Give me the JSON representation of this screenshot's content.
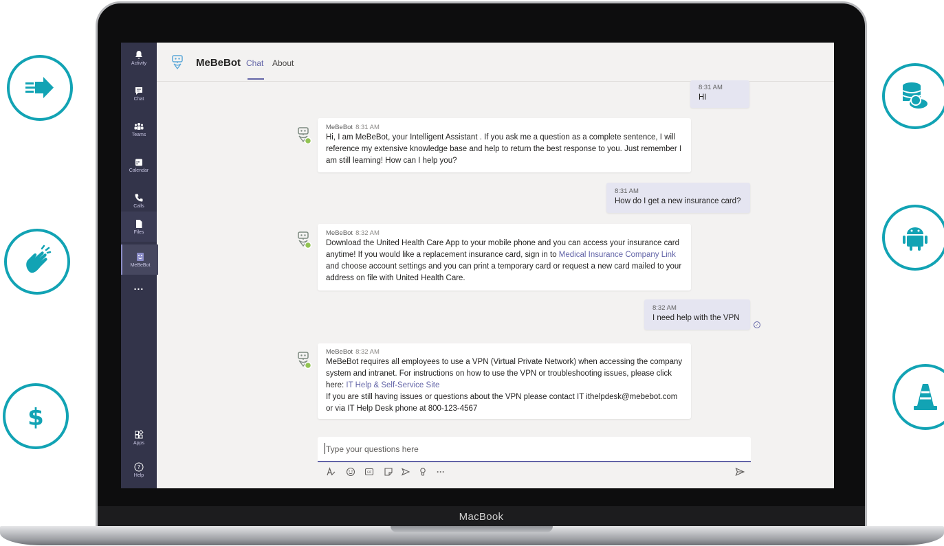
{
  "device": {
    "brand_label": "MacBook"
  },
  "side_icons": {
    "left": [
      "arrow-right-icon",
      "hand-wave-icon",
      "dollar-icon"
    ],
    "right": [
      "database-cloud-icon",
      "android-icon",
      "traffic-cone-icon"
    ],
    "accent_color": "#12a3b4"
  },
  "rail": {
    "items": [
      {
        "label": "Activity",
        "icon": "bell-icon"
      },
      {
        "label": "Chat",
        "icon": "chat-icon"
      },
      {
        "label": "Teams",
        "icon": "teams-icon"
      },
      {
        "label": "Calendar",
        "icon": "calendar-icon"
      },
      {
        "label": "Calls",
        "icon": "phone-icon"
      },
      {
        "label": "Files",
        "icon": "file-icon"
      },
      {
        "label": "MeBeBot",
        "icon": "bot-icon"
      }
    ],
    "more": "...",
    "bottom": [
      {
        "label": "Apps",
        "icon": "apps-icon"
      },
      {
        "label": "Help",
        "icon": "help-icon"
      }
    ],
    "colors": {
      "background": "#33344a",
      "accent": "#6264a7"
    }
  },
  "header": {
    "app_name": "MeBeBot",
    "tabs": [
      {
        "label": "Chat",
        "active": true
      },
      {
        "label": "About",
        "active": false
      }
    ]
  },
  "messages": [
    {
      "from": "user",
      "time": "8:31 AM",
      "text": "HI"
    },
    {
      "from": "bot",
      "sender": "MeBeBot",
      "time": "8:31 AM",
      "text": "Hi, I am MeBeBot, your Intelligent Assistant . If you ask me a question as a complete sentence, I will reference my extensive knowledge base and help to return the best response to you. Just remember I am still learning! How can I help you?"
    },
    {
      "from": "user",
      "time": "8:31 AM",
      "text": "How do I get a new insurance card?"
    },
    {
      "from": "bot",
      "sender": "MeBeBot",
      "time": "8:32 AM",
      "text_before": "Download the United Health Care App to your mobile phone and you can access your insurance card anytime! If you would like a replacement insurance card, sign in to ",
      "link": "Medical Insurance Company Link",
      "text_after": " and choose account settings and you can print a temporary card or request a new card mailed to your address on file with United Health Care."
    },
    {
      "from": "user",
      "time": "8:32 AM",
      "text": "I need help with the VPN"
    },
    {
      "from": "bot",
      "sender": "MeBeBot",
      "time": "8:32 AM",
      "text_before": "MeBeBot requires all employees to use a VPN (Virtual Private Network) when accessing the company system and intranet. For instructions on how to use the VPN or troubleshooting issues, please click here: ",
      "link": "IT Help & Self-Service Site",
      "text_after": "If you are still having issues or questions about the VPN please contact IT ithelpdesk@mebebot.com or via IT Help Desk phone at 800-123-4567"
    }
  ],
  "compose": {
    "placeholder": "Type your questions here",
    "tools": [
      "format-icon",
      "emoji-icon",
      "gif-icon",
      "sticker-icon",
      "meet-icon",
      "praise-icon",
      "more-icon",
      "send-icon"
    ],
    "more": "···"
  }
}
